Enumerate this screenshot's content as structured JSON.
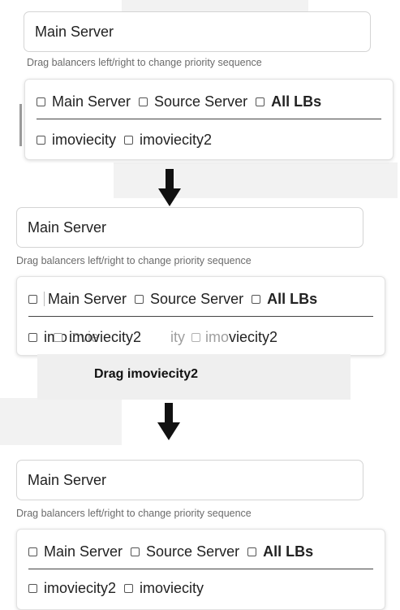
{
  "panels": [
    {
      "input_value": "Main Server",
      "hint": "Drag balancers left/right to change priority sequence",
      "row1": [
        {
          "label": "Main Server",
          "bold": false
        },
        {
          "label": "Source Server",
          "bold": false
        },
        {
          "label": "All LBs",
          "bold": true
        }
      ],
      "row2": [
        {
          "label": "imoviecity"
        },
        {
          "label": "imoviecity2"
        }
      ]
    },
    {
      "input_value": "Main Server",
      "hint": "Drag balancers left/right to change priority sequence",
      "row1": [
        {
          "label": "Main Server",
          "bold": false
        },
        {
          "label": "Source Server",
          "bold": false
        },
        {
          "label": "All LBs",
          "bold": true
        }
      ],
      "row2_fragments": {
        "left_text": "imo",
        "ghost_left_text": "vie",
        "ghost_middle_text": "ity",
        "ghost_right_text": "imo",
        "right_text": "viecity2"
      },
      "dragged_item": {
        "label": "imoviecity2"
      },
      "drag_caption": "Drag imoviecity2"
    },
    {
      "input_value": "Main Server",
      "hint": "Drag balancers left/right to change priority sequence",
      "row1": [
        {
          "label": "Main Server",
          "bold": false
        },
        {
          "label": "Source Server",
          "bold": false
        },
        {
          "label": "All LBs",
          "bold": true
        }
      ],
      "row2": [
        {
          "label": "imoviecity2"
        },
        {
          "label": "imoviecity"
        }
      ]
    }
  ],
  "arrows": [
    {
      "icon": "down-arrow-icon",
      "color": "#111111"
    },
    {
      "icon": "down-arrow-icon",
      "color": "#111111"
    }
  ]
}
